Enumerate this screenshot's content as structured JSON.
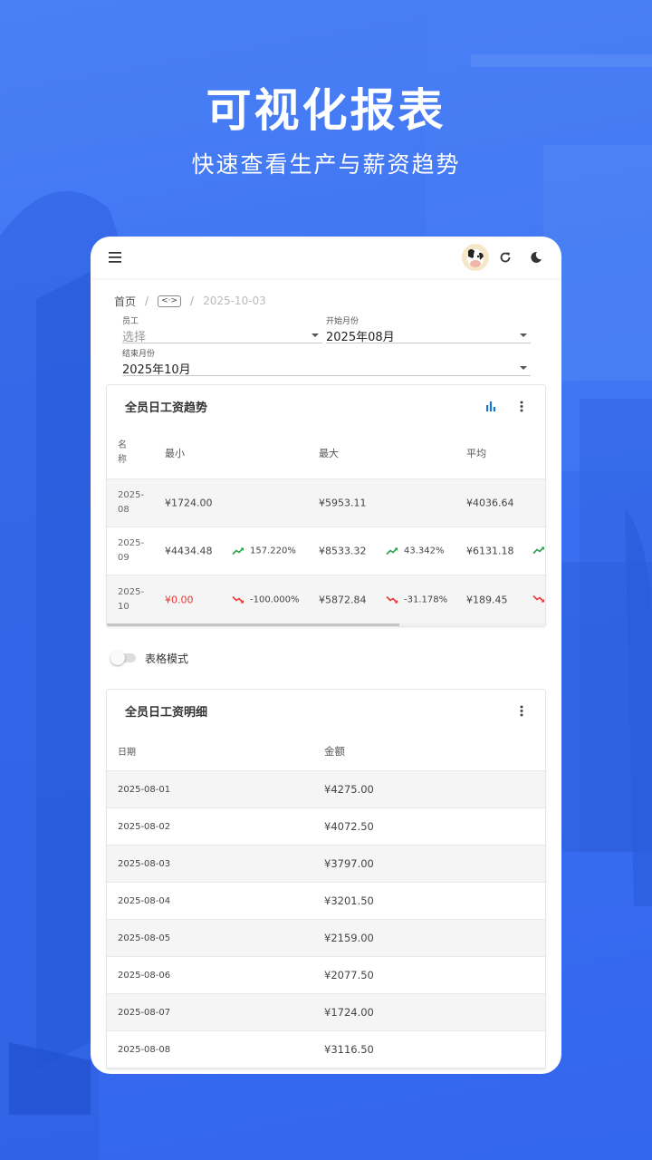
{
  "hero": {
    "title": "可视化报表",
    "subtitle": "快速查看生产与薪资趋势"
  },
  "colors": {
    "accent": "#1976d2",
    "up": "#2e9e4f",
    "down": "#e53935",
    "background": "#3a6ff0"
  },
  "breadcrumb": {
    "home": "首页",
    "code": "<·>",
    "date": "2025-10-03"
  },
  "filters": {
    "employee": {
      "label": "员工",
      "placeholder": "选择"
    },
    "start_month": {
      "label": "开始月份",
      "value": "2025年08月"
    },
    "end_month": {
      "label": "结束月份",
      "value": "2025年10月"
    }
  },
  "trend_card": {
    "title": "全员日工资趋势",
    "headers": {
      "name": "名称",
      "min": "最小",
      "max": "最大",
      "avg": "平均"
    },
    "rows": [
      {
        "name": "2025-08",
        "min": "¥1724.00",
        "max": "¥5953.11",
        "avg": "¥4036.64"
      },
      {
        "name": "2025-09",
        "min": "¥4434.48",
        "min_change": "157.220%",
        "max": "¥8533.32",
        "max_change": "43.342%",
        "avg": "¥6131.18"
      },
      {
        "name": "2025-10",
        "min": "¥0.00",
        "min_change": "-100.000%",
        "max": "¥5872.84",
        "max_change": "-31.178%",
        "avg": "¥189.45"
      }
    ]
  },
  "table_mode": {
    "label": "表格模式",
    "enabled": false
  },
  "detail_card": {
    "title": "全员日工资明细",
    "headers": {
      "date": "日期",
      "amount": "金额"
    },
    "rows": [
      {
        "date": "2025-08-01",
        "amount": "¥4275.00"
      },
      {
        "date": "2025-08-02",
        "amount": "¥4072.50"
      },
      {
        "date": "2025-08-03",
        "amount": "¥3797.00"
      },
      {
        "date": "2025-08-04",
        "amount": "¥3201.50"
      },
      {
        "date": "2025-08-05",
        "amount": "¥2159.00"
      },
      {
        "date": "2025-08-06",
        "amount": "¥2077.50"
      },
      {
        "date": "2025-08-07",
        "amount": "¥1724.00"
      },
      {
        "date": "2025-08-08",
        "amount": "¥3116.50"
      }
    ]
  },
  "icons": [
    "menu-icon",
    "avatar",
    "refresh-icon",
    "dark-mode-icon",
    "bar-chart-icon",
    "more-vert-icon",
    "trend-up-icon",
    "trend-down-icon"
  ]
}
